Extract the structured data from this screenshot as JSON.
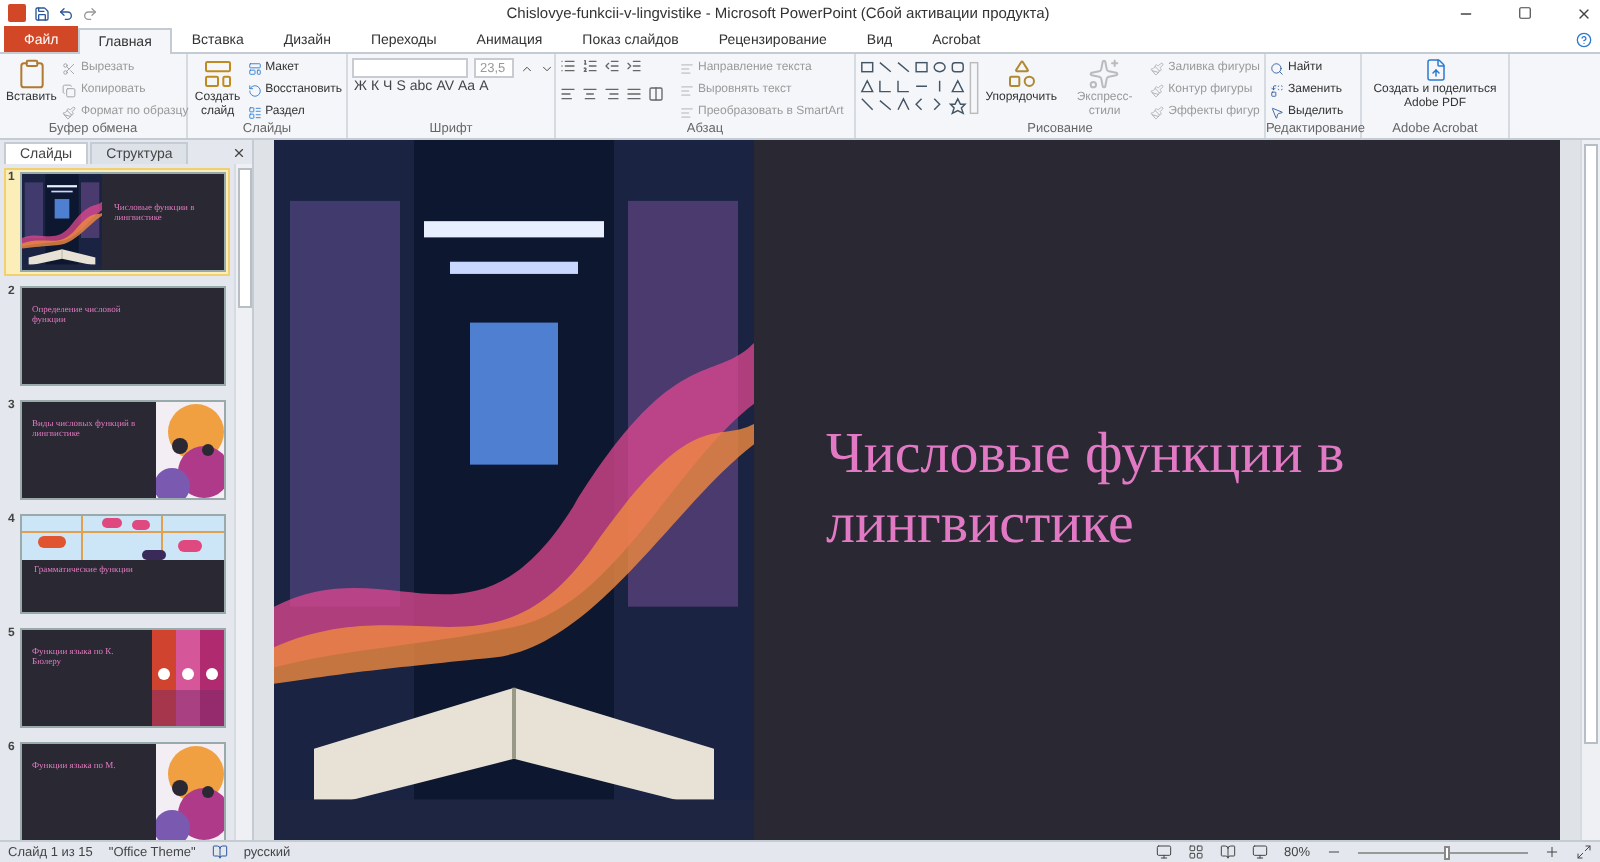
{
  "window": {
    "title": "Chislovye-funkcii-v-lingvistike - Microsoft PowerPoint (Сбой активации продукта)"
  },
  "tabs": [
    {
      "label": "Файл",
      "kind": "file",
      "selected": false
    },
    {
      "label": "Главная",
      "kind": "tab",
      "selected": true
    },
    {
      "label": "Вставка",
      "kind": "tab",
      "selected": false
    },
    {
      "label": "Дизайн",
      "kind": "tab",
      "selected": false
    },
    {
      "label": "Переходы",
      "kind": "tab",
      "selected": false
    },
    {
      "label": "Анимация",
      "kind": "tab",
      "selected": false
    },
    {
      "label": "Показ слайдов",
      "kind": "tab",
      "selected": false
    },
    {
      "label": "Рецензирование",
      "kind": "tab",
      "selected": false
    },
    {
      "label": "Вид",
      "kind": "tab",
      "selected": false
    },
    {
      "label": "Acrobat",
      "kind": "tab",
      "selected": false
    }
  ],
  "ribbon": {
    "clipboard": {
      "title": "Буфер обмена",
      "paste": "Вставить",
      "items": [
        {
          "label": "Вырезать",
          "disabled": true
        },
        {
          "label": "Копировать",
          "disabled": true
        },
        {
          "label": "Формат по образцу",
          "disabled": true
        }
      ]
    },
    "slides": {
      "title": "Слайды",
      "new_slide": "Создать слайд",
      "items": [
        {
          "label": "Макет",
          "disabled": false
        },
        {
          "label": "Восстановить",
          "disabled": false
        },
        {
          "label": "Раздел",
          "disabled": false
        }
      ]
    },
    "font": {
      "title": "Шрифт",
      "size": "23,5",
      "buttons": [
        "Ж",
        "К",
        "Ч",
        "S",
        "abc",
        "AV",
        "Aa",
        "A"
      ]
    },
    "paragraph": {
      "title": "Абзац",
      "items": [
        {
          "label": "Направление текста",
          "disabled": true
        },
        {
          "label": "Выровнять текст",
          "disabled": true
        },
        {
          "label": "Преобразовать в SmartArt",
          "disabled": true
        }
      ]
    },
    "drawing": {
      "title": "Рисование",
      "arrange": "Упорядочить",
      "quick_styles": "Экспресс-стили",
      "items": [
        {
          "label": "Заливка фигуры",
          "disabled": true
        },
        {
          "label": "Контур фигуры",
          "disabled": true
        },
        {
          "label": "Эффекты фигур",
          "disabled": true
        }
      ]
    },
    "editing": {
      "title": "Редактирование",
      "items": [
        {
          "label": "Найти",
          "disabled": false
        },
        {
          "label": "Заменить",
          "disabled": false
        },
        {
          "label": "Выделить",
          "disabled": false
        }
      ]
    },
    "acrobat": {
      "title": "Adobe Acrobat",
      "button": "Создать и поделиться Adobe PDF"
    }
  },
  "pane": {
    "tabs": [
      {
        "label": "Слайды",
        "selected": true
      },
      {
        "label": "Структура",
        "selected": false
      }
    ],
    "slides": [
      {
        "number": "1",
        "title": "Числовые функции в лингвистике",
        "kind": "picture-left",
        "selected": true
      },
      {
        "number": "2",
        "title": "Определение числовой функции",
        "kind": "plain",
        "selected": false
      },
      {
        "number": "3",
        "title": "Виды числовых функций в лингвистике",
        "kind": "picture-right",
        "selected": false
      },
      {
        "number": "4",
        "title": "Грамматические функции",
        "kind": "picture-top",
        "selected": false
      },
      {
        "number": "5",
        "title": "Функции языка по К. Бюлеру",
        "kind": "stripes-right",
        "selected": false
      },
      {
        "number": "6",
        "title": "Функции языка по М.",
        "kind": "picture-right",
        "selected": false
      }
    ]
  },
  "slide": {
    "title": "Числовые функции в лингвистике"
  },
  "status_bar": {
    "slide": "Слайд 1 из 15",
    "theme": "\"Office Theme\"",
    "language": "русский",
    "zoom": "80%",
    "zoom_slider": {
      "level": 0.5
    }
  }
}
